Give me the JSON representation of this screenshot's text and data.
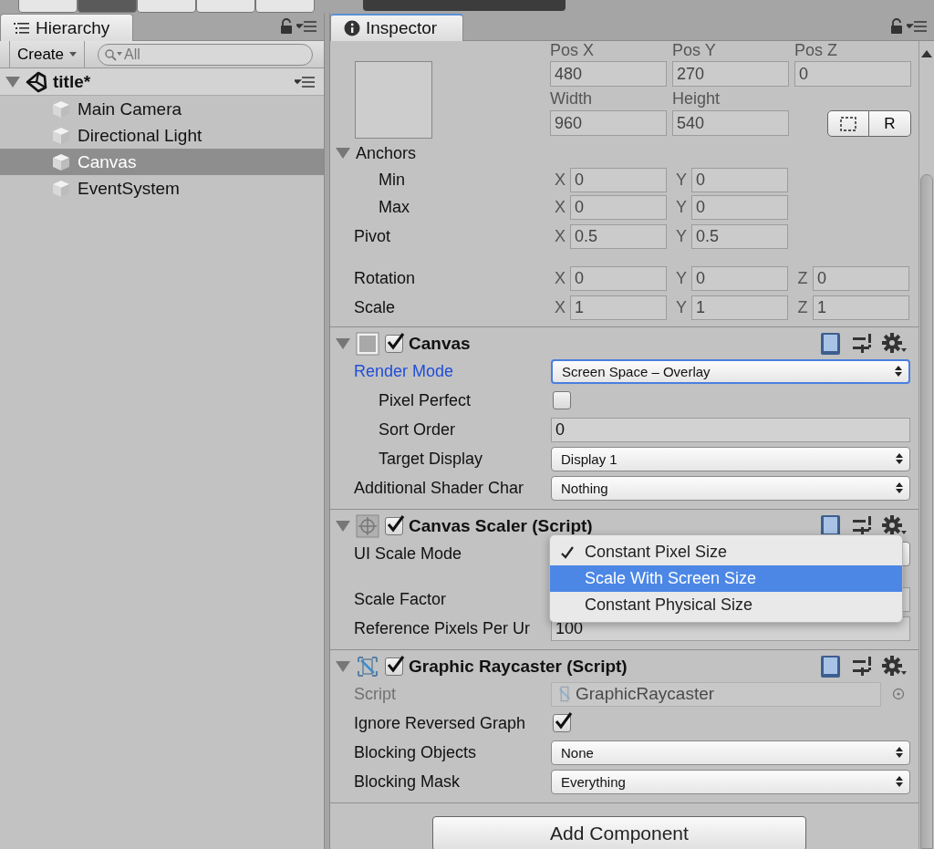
{
  "hierarchy": {
    "tab": "Hierarchy",
    "create": "Create",
    "search_placeholder": "All",
    "scene": {
      "name": "title*",
      "expanded": true,
      "children": [
        {
          "name": "Main Camera",
          "selected": false
        },
        {
          "name": "Directional Light",
          "selected": false
        },
        {
          "name": "Canvas",
          "selected": true
        },
        {
          "name": "EventSystem",
          "selected": false
        }
      ]
    }
  },
  "inspector": {
    "tab": "Inspector",
    "rect": {
      "pos": [
        {
          "label": "Pos X",
          "value": "480"
        },
        {
          "label": "Pos Y",
          "value": "270"
        },
        {
          "label": "Pos Z",
          "value": "0"
        }
      ],
      "size": [
        {
          "label": "Width",
          "value": "960"
        },
        {
          "label": "Height",
          "value": "540"
        }
      ],
      "raw_button": "R",
      "anchors": {
        "label": "Anchors",
        "expanded": true,
        "children": [
          {
            "label": "Min",
            "fields": [
              {
                "axis": "X",
                "value": "0"
              },
              {
                "axis": "Y",
                "value": "0"
              }
            ]
          },
          {
            "label": "Max",
            "fields": [
              {
                "axis": "X",
                "value": "0"
              },
              {
                "axis": "Y",
                "value": "0"
              }
            ]
          }
        ]
      },
      "pivot": {
        "label": "Pivot",
        "fields": [
          {
            "axis": "X",
            "value": "0.5"
          },
          {
            "axis": "Y",
            "value": "0.5"
          }
        ]
      },
      "rotation": {
        "label": "Rotation",
        "fields": [
          {
            "axis": "X",
            "value": "0"
          },
          {
            "axis": "Y",
            "value": "0"
          },
          {
            "axis": "Z",
            "value": "0"
          }
        ]
      },
      "scale": {
        "label": "Scale",
        "fields": [
          {
            "axis": "X",
            "value": "1"
          },
          {
            "axis": "Y",
            "value": "1"
          },
          {
            "axis": "Z",
            "value": "1"
          }
        ]
      }
    },
    "components": [
      {
        "name": "Canvas",
        "enabled": true,
        "expanded": true,
        "properties": [
          {
            "label": "Render Mode",
            "kind": "dropdown",
            "value": "Screen Space – Overlay",
            "focused": true,
            "disabled": false,
            "children": [
              {
                "label": "Pixel Perfect",
                "kind": "checkbox",
                "checked": false,
                "focused": false,
                "disabled": false
              },
              {
                "label": "Sort Order",
                "kind": "field",
                "value": "0",
                "focused": false,
                "disabled": false
              },
              {
                "label": "Target Display",
                "kind": "dropdown",
                "value": "Display 1",
                "focused": false,
                "disabled": false
              }
            ]
          },
          {
            "label": "Additional Shader Char",
            "kind": "dropdown",
            "value": "Nothing",
            "focused": false,
            "disabled": false
          }
        ]
      },
      {
        "name": "Canvas Scaler (Script)",
        "enabled": true,
        "expanded": true,
        "properties": [
          {
            "label": "UI Scale Mode",
            "kind": "dropdown",
            "open": true,
            "focused": false,
            "disabled": false,
            "options": [
              {
                "label": "Constant Pixel Size",
                "checked": true,
                "selected": false
              },
              {
                "label": "Scale With Screen Size",
                "checked": false,
                "selected": true
              },
              {
                "label": "Constant Physical Size",
                "checked": false,
                "selected": false
              }
            ]
          },
          {
            "label": "Scale Factor",
            "kind": "field",
            "focused": false,
            "disabled": false
          },
          {
            "label": "Reference Pixels Per Ur",
            "kind": "field",
            "value": "100",
            "focused": false,
            "disabled": false
          }
        ]
      },
      {
        "name": "Graphic Raycaster (Script)",
        "enabled": true,
        "expanded": true,
        "properties": [
          {
            "label": "Script",
            "kind": "object",
            "value": "GraphicRaycaster",
            "focused": false,
            "disabled": true
          },
          {
            "label": "Ignore Reversed Graph",
            "kind": "checkbox",
            "checked": true,
            "focused": false,
            "disabled": false
          },
          {
            "label": "Blocking Objects",
            "kind": "dropdown",
            "value": "None",
            "focused": false,
            "disabled": false
          },
          {
            "label": "Blocking Mask",
            "kind": "dropdown",
            "value": "Everything",
            "focused": false,
            "disabled": false
          }
        ]
      }
    ],
    "add_component": "Add Component"
  }
}
